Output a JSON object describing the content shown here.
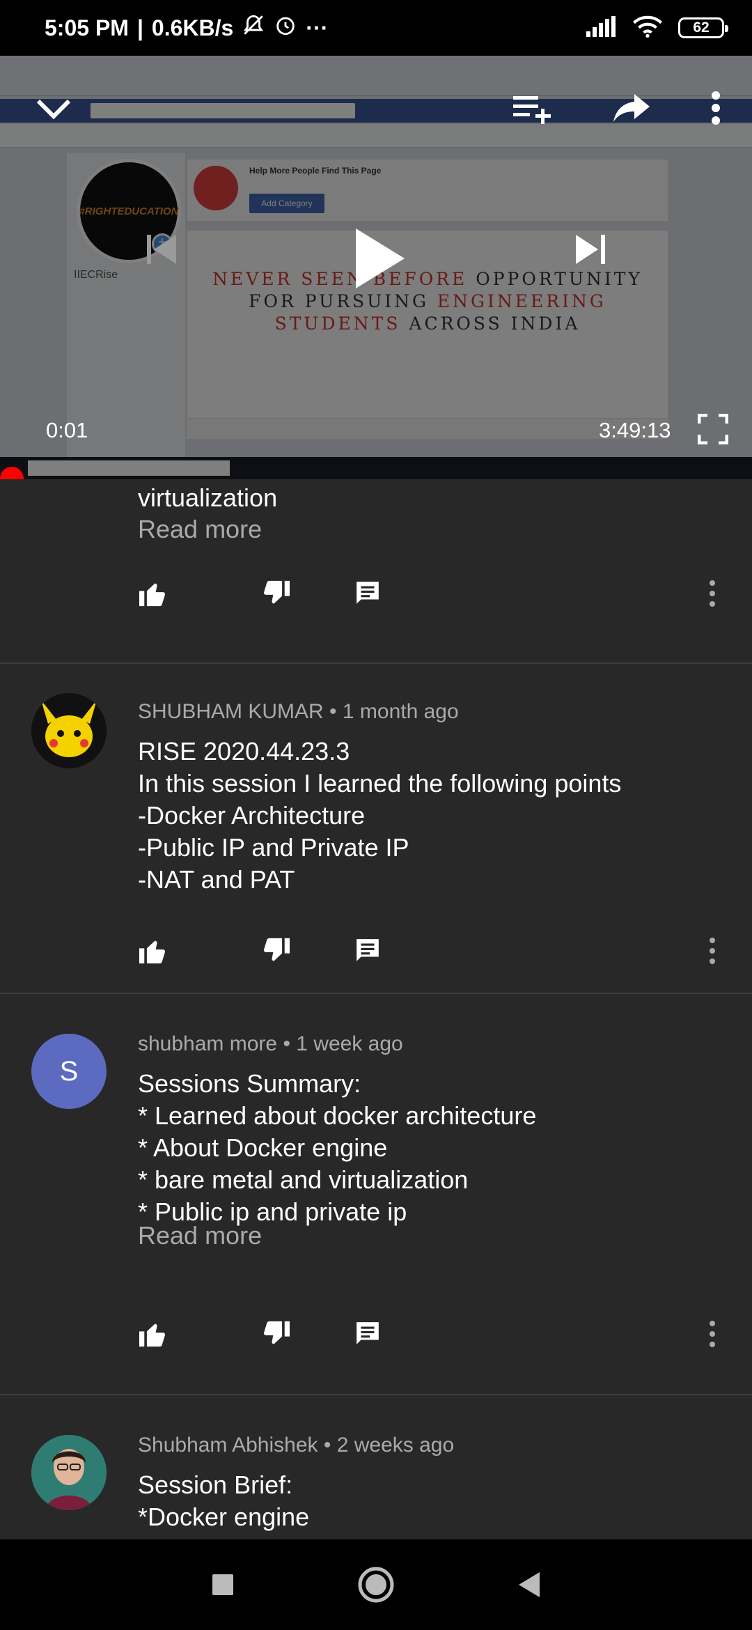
{
  "status_bar": {
    "time": "5:05 PM",
    "separator": "|",
    "net_speed": "0.6KB/s",
    "more": "···",
    "battery": "62"
  },
  "player": {
    "current_time": "0:01",
    "duration": "3:49:13",
    "progress": 0.0,
    "video_frame": {
      "page_name": "IIECRise",
      "help_title": "Help More People Find This Page",
      "add_category": "Add Category",
      "banner_line1_a": "NEVER SEEN BEFORE",
      "banner_line1_b": " OPPORTUNITY",
      "banner_line2_a": "FOR PURSUING ",
      "banner_line2_b": "ENGINEERING",
      "banner_line3_a": "STUDENTS",
      "banner_line3_b": " ACROSS INDIA",
      "profile_text": "#RIGHTEDUCATION"
    }
  },
  "comments": [
    {
      "body": "virtualization",
      "read_more": "Read more"
    },
    {
      "author": "SHUBHAM KUMAR",
      "age": "1 month ago",
      "body": "RISE 2020.44.23.3\nIn this session I learned the following points\n-Docker Architecture\n-Public IP and Private IP\n-NAT and PAT"
    },
    {
      "author": "shubham more",
      "age": "1 week ago",
      "avatar_letter": "S",
      "body": "Sessions Summary:\n* Learned about docker architecture\n* About Docker engine\n* bare metal and virtualization\n* Public ip and private ip",
      "read_more": "Read more"
    },
    {
      "author": "Shubham Abhishek",
      "age": "2 weeks ago",
      "body": "Session Brief:\n*Docker engine"
    }
  ],
  "colors": {
    "background": "#282828",
    "avatar_s": "#5c6bc0",
    "progress_red": "#ff0000"
  }
}
